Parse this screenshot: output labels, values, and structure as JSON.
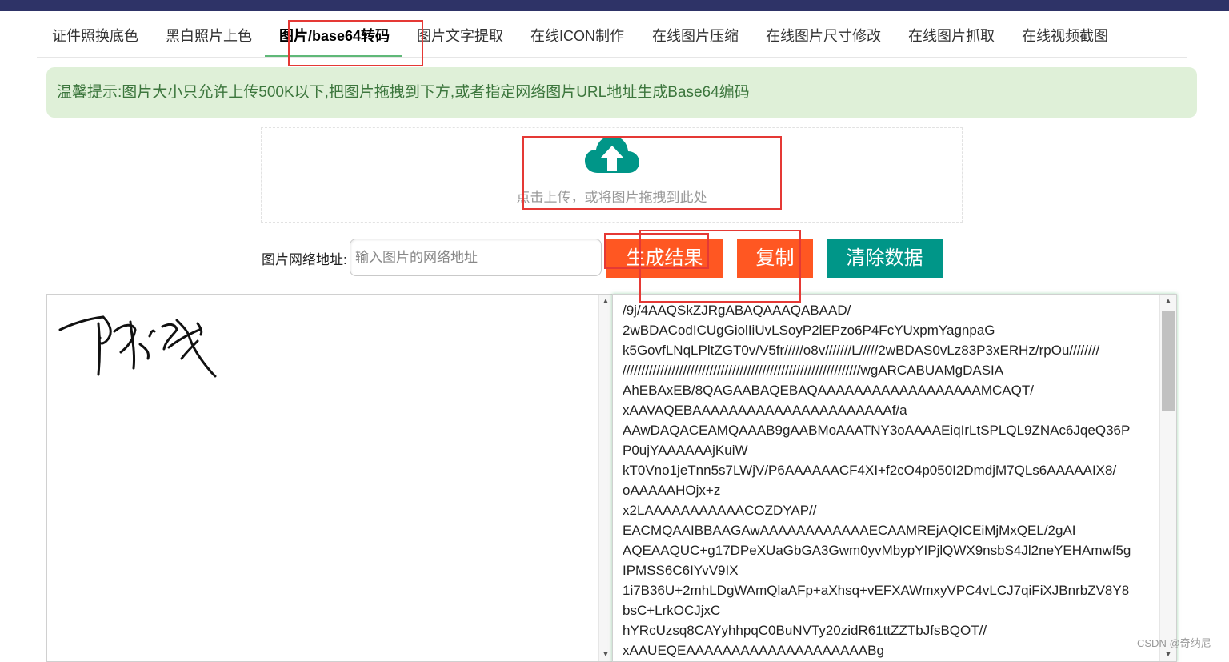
{
  "tabs": [
    {
      "label": "证件照换底色",
      "active": false
    },
    {
      "label": "黑白照片上色",
      "active": false
    },
    {
      "label": "图片/base64转码",
      "active": true
    },
    {
      "label": "图片文字提取",
      "active": false
    },
    {
      "label": "在线ICON制作",
      "active": false
    },
    {
      "label": "在线图片压缩",
      "active": false
    },
    {
      "label": "在线图片尺寸修改",
      "active": false
    },
    {
      "label": "在线图片抓取",
      "active": false
    },
    {
      "label": "在线视频截图",
      "active": false
    }
  ],
  "notice": "温馨提示:图片大小只允许上传500K以下,把图片拖拽到下方,或者指定网络图片URL地址生成Base64编码",
  "upload": {
    "text": "点击上传，或将图片拖拽到此处",
    "icon": "cloud-upload-icon"
  },
  "url": {
    "label": "图片网络地址:",
    "placeholder": "输入图片的网络地址",
    "value": ""
  },
  "buttons": {
    "generate": "生成结果",
    "copy": "复制",
    "clear": "清除数据"
  },
  "result_lines": [
    "/9j/4AAQSkZJRgABAQAAAQABAAD/",
    "2wBDACodICUgGiolIiUvLSoyP2lEPzo6P4FcYUxpmYagnpaG",
    "k5GovfLNqLPltZGT0v/V5fr/////o8v///////L/////2wBDAS0vLz83P3xERHz/rpOu////////",
    "///////////////////////////////////////////////////////////////wgARCABUAMgDASIA",
    "AhEBAxEB/8QAGAABAQEBAQAAAAAAAAAAAAAAAAAAMCAQT/",
    "xAAVAQEBAAAAAAAAAAAAAAAAAAAAAAf/a",
    "AAwDAQACEAMQAAAB9gAABMoAAATNY3oAAAAEiqIrLtSPLQL9ZNAc6JqeQ36P",
    "P0ujYAAAAAAjKuiW",
    "kT0Vno1jeTnn5s7LWjV/P6AAAAAACF4XI+f2cO4p050I2DmdjM7QLs6AAAAAIX8/",
    "oAAAAAHOjx+z",
    "x2LAAAAAAAAAAACOZDYAP//",
    "EACMQAAIBBAAGAwAAAAAAAAAAAAECAAMREjAQICEiMjMxQEL/2gAI",
    "AQEAAQUC+g17DPeXUaGbGA3Gwm0yvMbypYIPjlQWX9nsbS4Jl2neYEHAmwf5g",
    "IPMSS6C6IYvV9IX",
    "1i7B36U+2mhLDgWAmQlaAFp+aXhsq+vEFXAWmxyVPC4vLCJ7qiFiXJBnrbZV8Y8",
    "bsC+LrkOCJjxC",
    "hYRcUzsq8CAYyhhpqC0BuNVTy20zidR61ttZZTbJfsBQOT//",
    "xAAUEQEAAAAAAAAAAAAAAAAAAAABg"
  ],
  "watermark": "CSDN @奇纳尼",
  "colors": {
    "accent_orange": "#ff5722",
    "accent_teal": "#009688",
    "notice_bg": "#dff0d8",
    "notice_text": "#3c763d",
    "topbar": "#2e3367"
  },
  "result_scrollbar_position": 0.0
}
